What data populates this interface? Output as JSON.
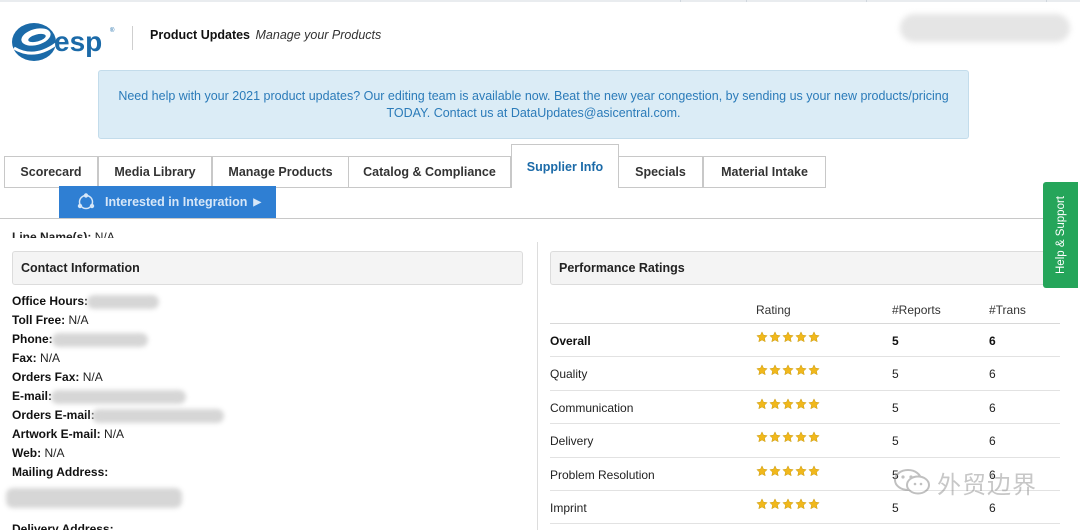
{
  "header": {
    "logo_text": "esp",
    "title": "Product Updates",
    "subtitle": "Manage your Products"
  },
  "banner": {
    "line1": "Need help with your 2021 product updates? Our editing team is available now. Beat the new year congestion, by sending us your new products/pricing",
    "line2": "TODAY.  Contact us at DataUpdates@asicentral.com."
  },
  "tabs": [
    {
      "label": "Scorecard",
      "active": false
    },
    {
      "label": "Media Library",
      "active": false
    },
    {
      "label": "Manage Products",
      "active": false
    },
    {
      "label": "Catalog & Compliance",
      "active": false
    },
    {
      "label": "Supplier Info",
      "active": true
    },
    {
      "label": "Specials",
      "active": false
    },
    {
      "label": "Material Intake",
      "active": false
    }
  ],
  "integration_button": {
    "label": "Interested in Integration"
  },
  "line_names": {
    "label": "Line Name(s):",
    "value": "N/A"
  },
  "contact": {
    "heading": "Contact Information",
    "fields": [
      {
        "label": "Office Hours:",
        "value": ""
      },
      {
        "label": "Toll Free:",
        "value": "N/A"
      },
      {
        "label": "Phone:",
        "value": ""
      },
      {
        "label": "Fax:",
        "value": "N/A"
      },
      {
        "label": "Orders Fax:",
        "value": "N/A"
      },
      {
        "label": "E-mail:",
        "value": ""
      },
      {
        "label": "Orders E-mail:",
        "value": ""
      },
      {
        "label": "Artwork E-mail:",
        "value": "N/A"
      },
      {
        "label": "Web:",
        "value": "N/A"
      },
      {
        "label": "Mailing Address:",
        "value": ""
      },
      {
        "label": "",
        "value": ""
      },
      {
        "label": "Delivery Address:",
        "value": ""
      }
    ]
  },
  "performance": {
    "heading": "Performance Ratings",
    "columns": {
      "rating": "Rating",
      "reports": "#Reports",
      "trans": "#Trans"
    },
    "rows": [
      {
        "name": "Overall",
        "stars": 5,
        "reports": "5",
        "trans": "6",
        "bold": true
      },
      {
        "name": "Quality",
        "stars": 5,
        "reports": "5",
        "trans": "6",
        "bold": false
      },
      {
        "name": "Communication",
        "stars": 5,
        "reports": "5",
        "trans": "6",
        "bold": false
      },
      {
        "name": "Delivery",
        "stars": 5,
        "reports": "5",
        "trans": "6",
        "bold": false
      },
      {
        "name": "Problem Resolution",
        "stars": 5,
        "reports": "5",
        "trans": "6",
        "bold": false
      },
      {
        "name": "Imprint",
        "stars": 5,
        "reports": "5",
        "trans": "6",
        "bold": false
      }
    ]
  },
  "help_tab": {
    "label": "Help & Support"
  },
  "watermark": {
    "text": "外贸边界"
  },
  "colors": {
    "brand_blue": "#1b6aa8",
    "integration_blue": "#2f7fd3",
    "banner_bg": "#dbecf6",
    "help_green": "#25a55a",
    "star_gold": "#f1b81c"
  }
}
